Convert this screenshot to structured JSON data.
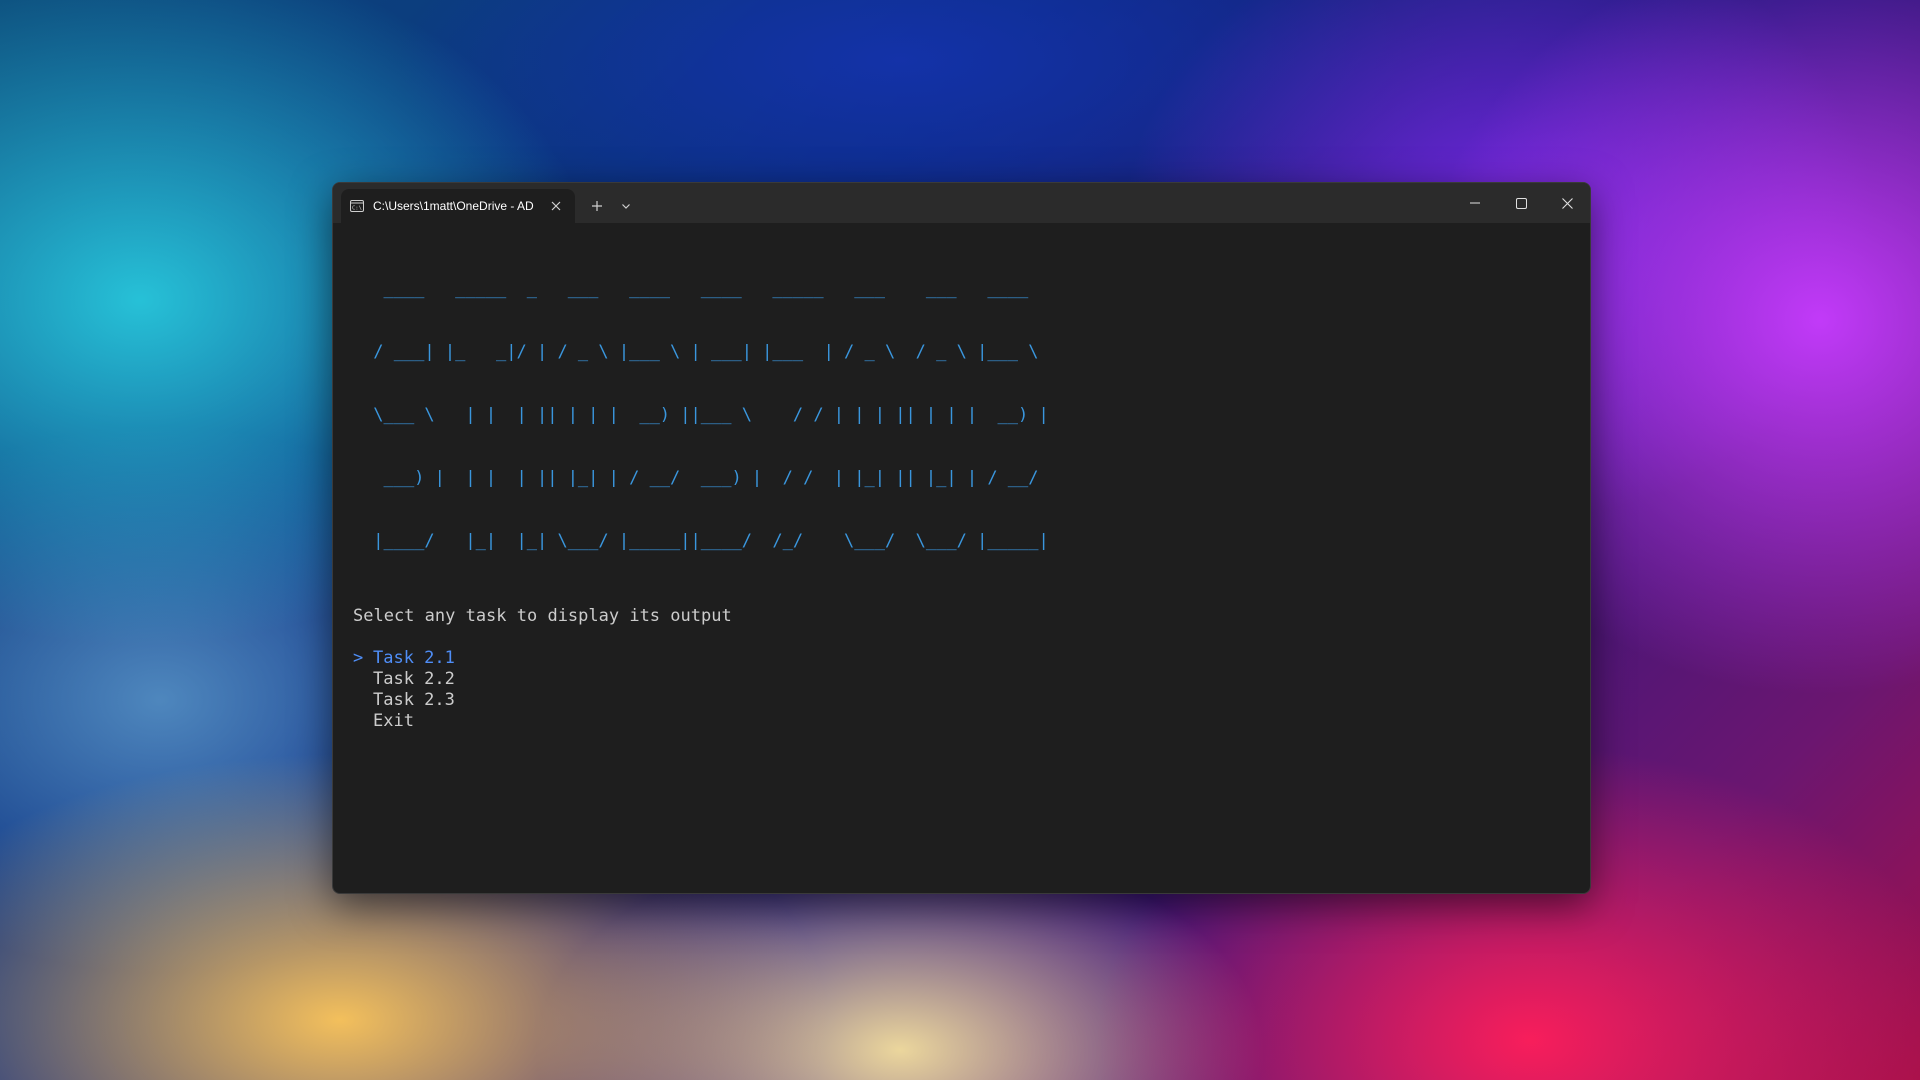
{
  "window": {
    "tab_title": "C:\\Users\\1matt\\OneDrive - AD",
    "tab_icon": "terminal-icon"
  },
  "terminal": {
    "banner": [
      "  ____   _____  _   ___   ____   ____   _____   ___    ___   ____  ",
      " / ___| |_   _|/ | / _ \\ |___ \\ | ___| |___  | / _ \\  / _ \\ |___ \\ ",
      " \\___ \\   | |  | || | | |  __) ||___ \\    / / | | | || | | |  __) |",
      "  ___) |  | |  | || |_| | / __/  ___) |  / /  | |_| || |_| | / __/ ",
      " |____/   |_|  |_| \\___/ |_____||____/  /_/    \\___/  \\___/ |_____|"
    ],
    "prompt": "Select any task to display its output",
    "menu": [
      {
        "marker": ">",
        "label": "Task 2.1"
      },
      {
        "marker": "",
        "label": "Task 2.2"
      },
      {
        "marker": "",
        "label": "Task 2.3"
      },
      {
        "marker": "",
        "label": "Exit"
      }
    ],
    "colors": {
      "background": "#1e1e1e",
      "banner": "#3a96dd",
      "text": "#cccccc",
      "selected": "#4f8ef7"
    }
  }
}
